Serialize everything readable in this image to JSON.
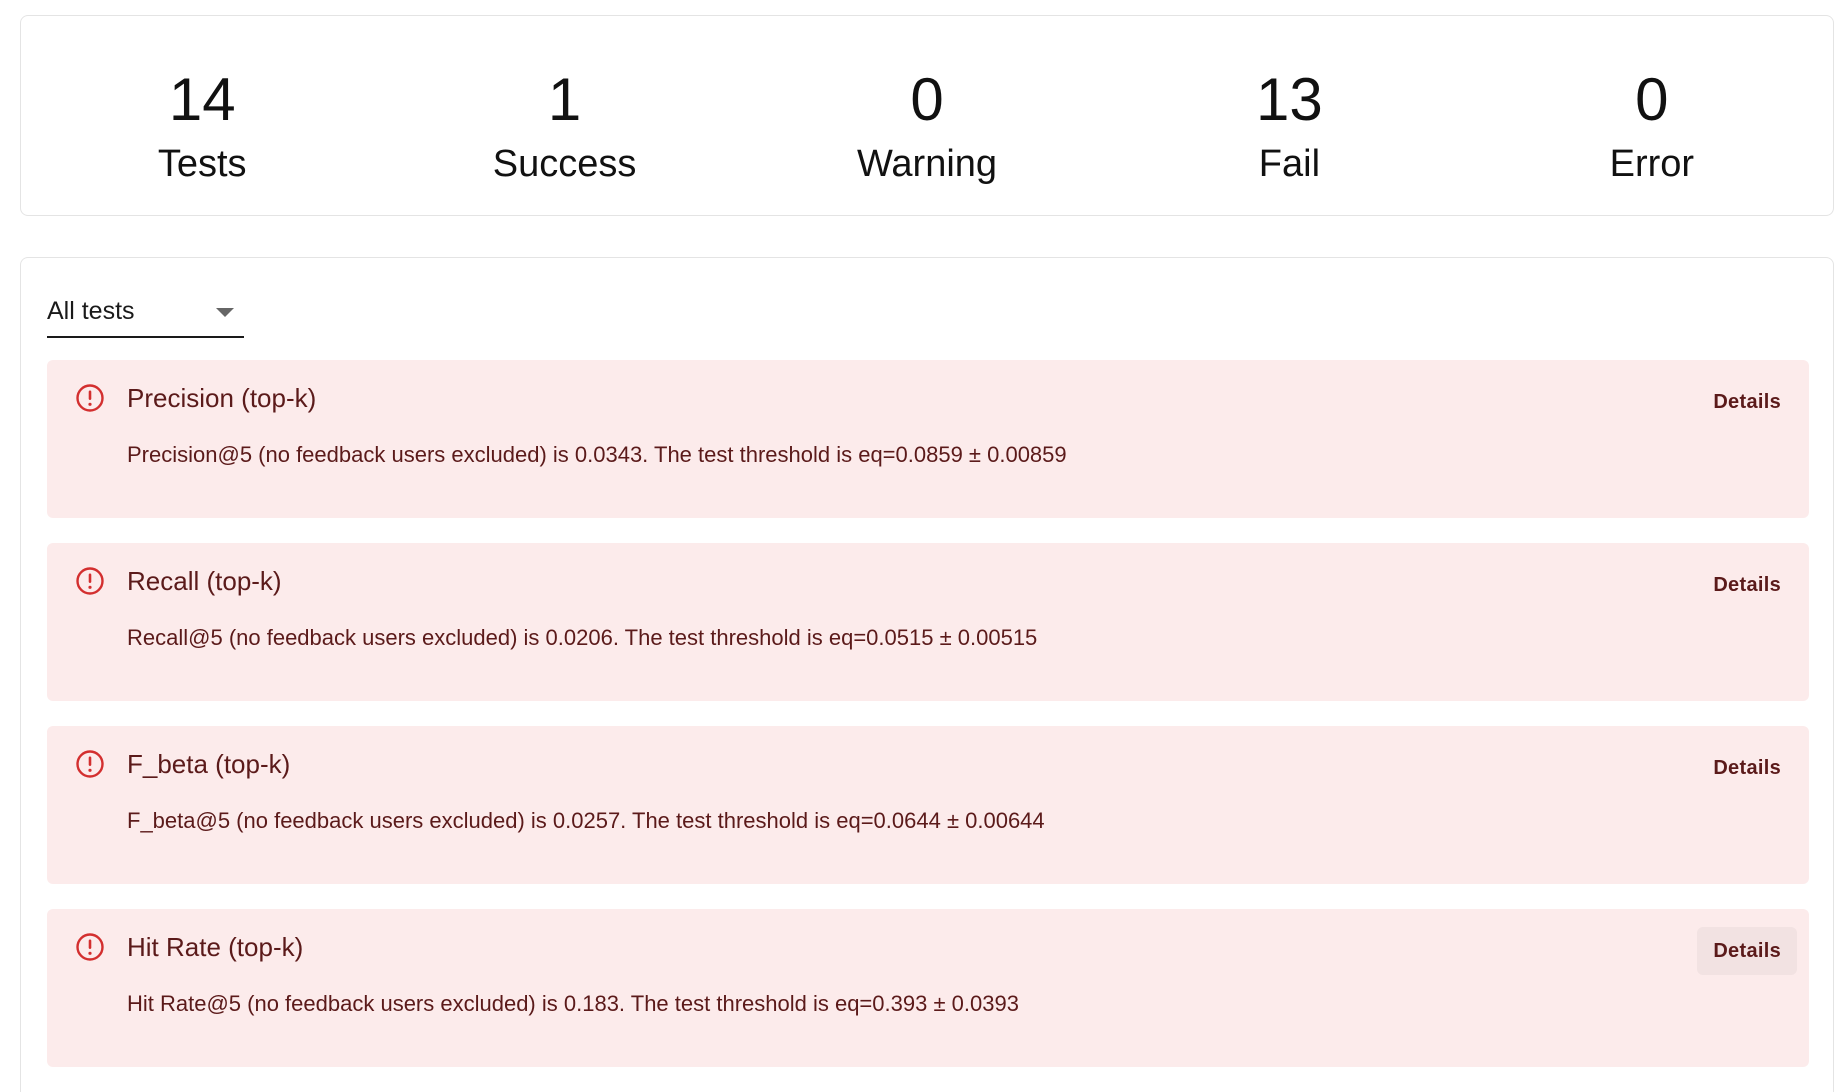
{
  "summary": {
    "tests": {
      "count": "14",
      "label": "Tests"
    },
    "success": {
      "count": "1",
      "label": "Success"
    },
    "warning": {
      "count": "0",
      "label": "Warning"
    },
    "fail": {
      "count": "13",
      "label": "Fail"
    },
    "error": {
      "count": "0",
      "label": "Error"
    }
  },
  "filter": {
    "selected": "All tests"
  },
  "colors": {
    "fail_background": "#fcebeb",
    "fail_text": "#5b1a1a",
    "fail_icon": "#d32f2f"
  },
  "tests": [
    {
      "status_icon": "alert-circle-icon",
      "title": "Precision (top-k)",
      "description": "Precision@5 (no feedback users excluded) is 0.0343. The test threshold is eq=0.0859 ± 0.00859",
      "details_label": "Details"
    },
    {
      "status_icon": "alert-circle-icon",
      "title": "Recall (top-k)",
      "description": "Recall@5 (no feedback users excluded) is 0.0206. The test threshold is eq=0.0515 ± 0.00515",
      "details_label": "Details"
    },
    {
      "status_icon": "alert-circle-icon",
      "title": "F_beta (top-k)",
      "description": "F_beta@5 (no feedback users excluded) is 0.0257. The test threshold is eq=0.0644 ± 0.00644",
      "details_label": "Details"
    },
    {
      "status_icon": "alert-circle-icon",
      "title": "Hit Rate (top-k)",
      "description": "Hit Rate@5 (no feedback users excluded) is 0.183. The test threshold is eq=0.393 ± 0.0393",
      "details_label": "Details"
    }
  ]
}
